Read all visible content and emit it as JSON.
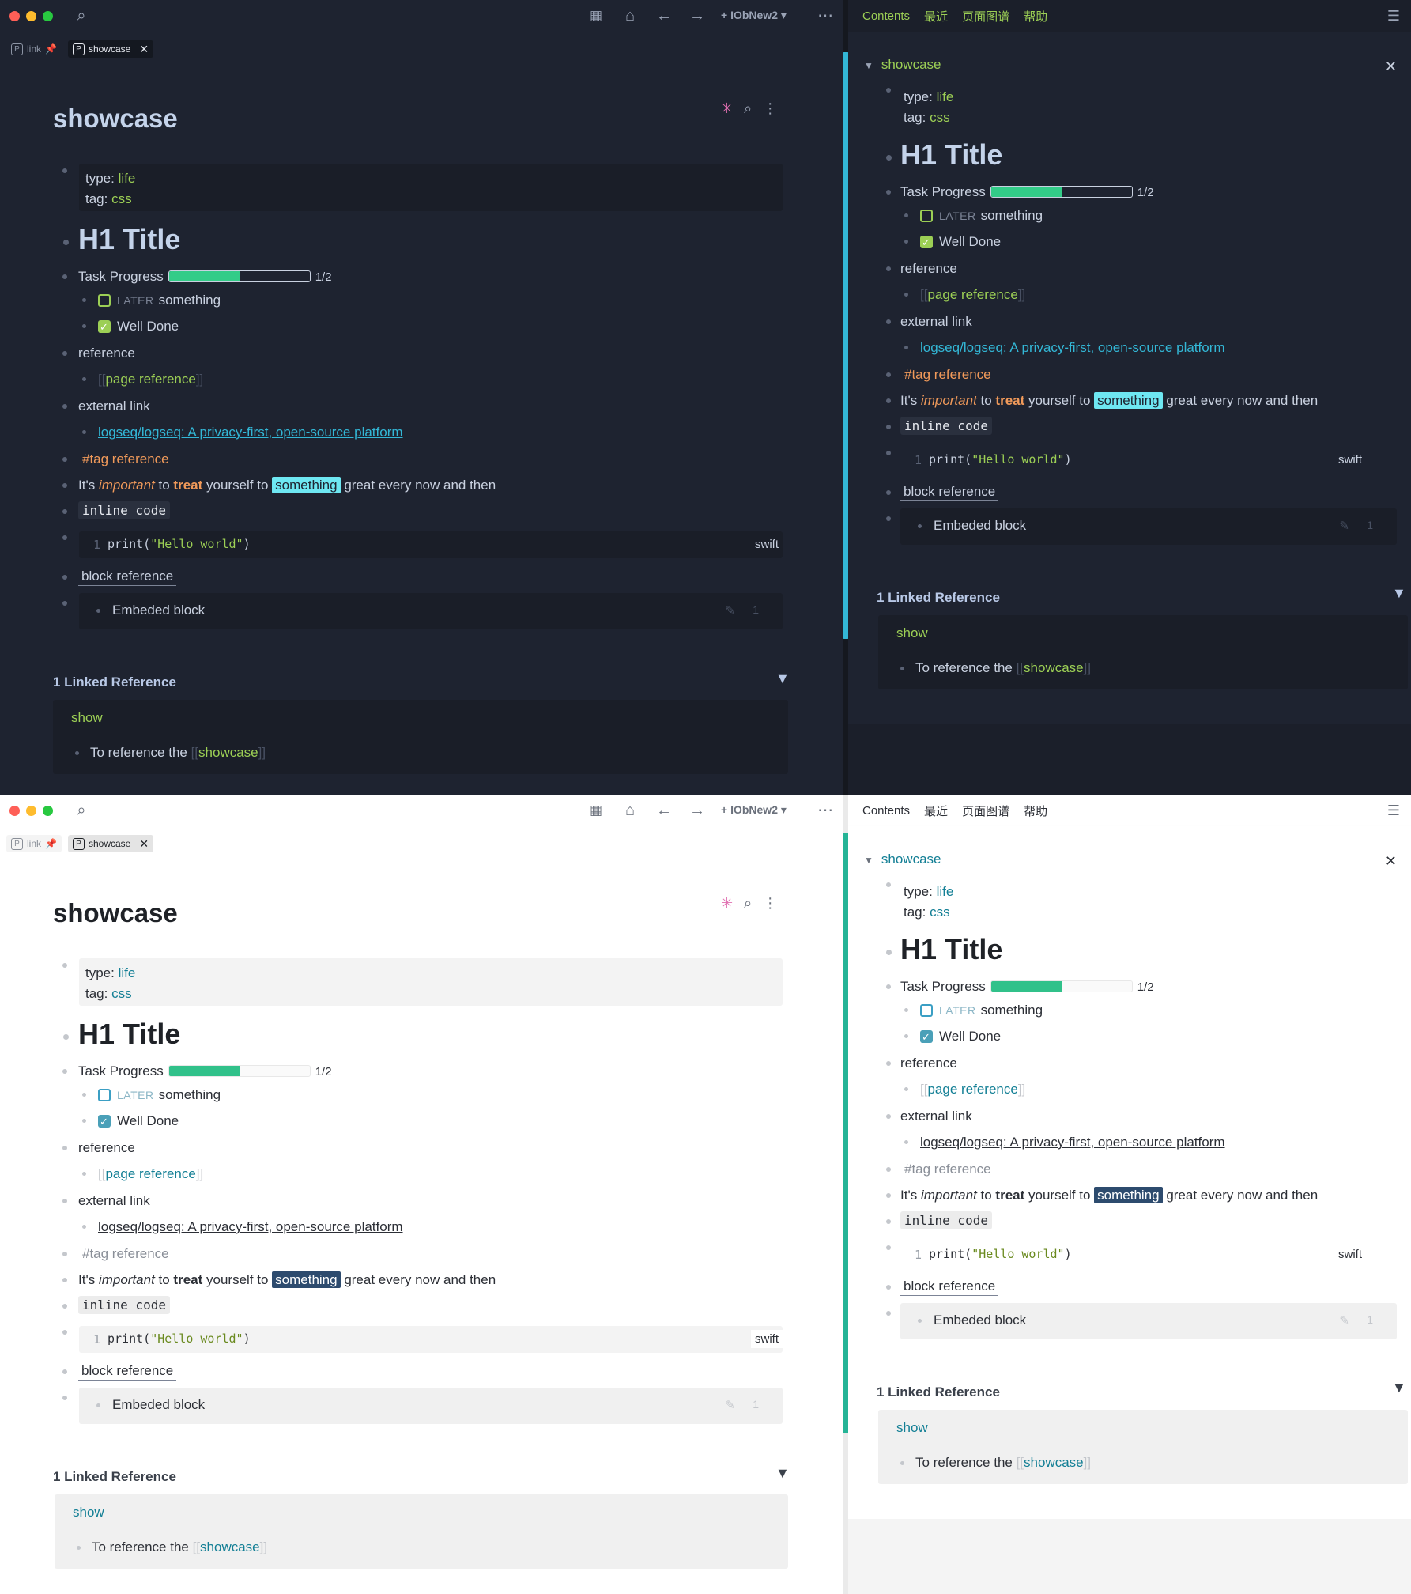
{
  "toolbar": {
    "workspace": "IObNew2",
    "search_icon": "search-icon",
    "calendar_icon": "calendar-icon",
    "home_icon": "home-icon",
    "back_icon": "arrow-left-icon",
    "forward_icon": "arrow-right-icon",
    "more_icon": "more-horizontal-icon"
  },
  "tabs": [
    {
      "label": "link",
      "pinned": true
    },
    {
      "label": "showcase",
      "active": true
    }
  ],
  "page": {
    "title": "showcase",
    "props": {
      "type_key": "type: ",
      "type_val": "life",
      "tag_key": "tag: ",
      "tag_val": "css"
    },
    "h1": "H1 Title",
    "task_progress_label": "Task Progress",
    "task_progress_fraction": "1/2",
    "task_progress_value": 0.5,
    "task1_marker": "LATER",
    "task1_text": "something",
    "task2_text": "Well Done",
    "reference_label": "reference",
    "page_reference_open": "[[",
    "page_reference": "page reference",
    "page_reference_close": "]]",
    "external_label": "external link",
    "external_link": "logseq/logseq: A privacy-first, open-source platform",
    "tag_reference": "#tag reference",
    "sentence_a": "It's ",
    "sentence_imp": "important",
    "sentence_b": " to ",
    "sentence_treat": "treat",
    "sentence_c": " yourself to ",
    "sentence_hl": "something",
    "sentence_d": " great every now and then",
    "inline_code": "inline code",
    "code_line_no": "1",
    "code_fn": "print(",
    "code_str": "\"Hello world\"",
    "code_close": ")",
    "code_lang": "swift",
    "block_reference": "block reference",
    "embedded_block": "Embeded block",
    "embed_count": "1",
    "linked_reference_title": "1 Linked Reference",
    "linked_page": "show",
    "linked_text": "To reference the ",
    "linked_ref_open": "[[",
    "linked_ref": "showcase",
    "linked_ref_close": "]]"
  },
  "sidebar": {
    "nav": [
      "Contents",
      "最近",
      "页面图谱",
      "帮助"
    ],
    "menu_icon": "hamburger-menu-icon",
    "title": "showcase"
  },
  "themes": {
    "dark": {
      "accent": "#33b7d6",
      "link_green": "#9ccf55",
      "orange": "#f19a5a"
    },
    "light": {
      "accent": "#25b496",
      "link_teal": "#137f95"
    }
  }
}
